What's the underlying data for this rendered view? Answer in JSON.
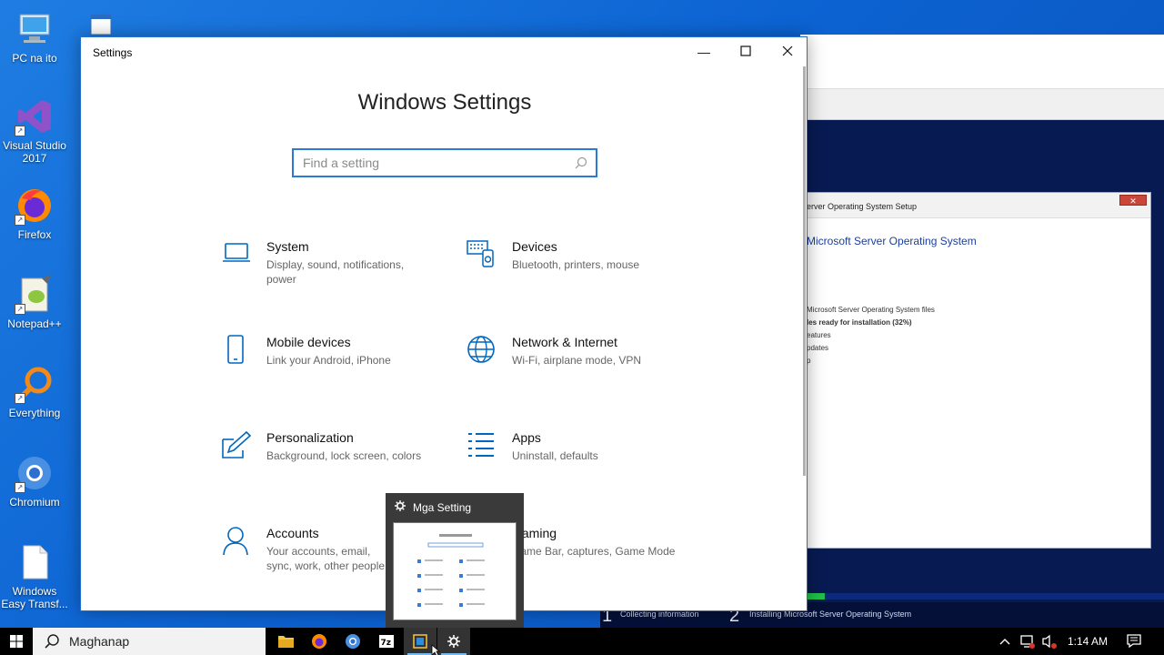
{
  "desktop": {
    "icons": [
      {
        "label": "PC na ito"
      },
      {
        "label": "Visual Studio 2017"
      },
      {
        "label": "Firefox"
      },
      {
        "label": "Notepad++"
      },
      {
        "label": "Everything"
      },
      {
        "label": "Chromium"
      },
      {
        "label": "Windows Easy Transf..."
      }
    ]
  },
  "background_window": {
    "setup_title": "erver Operating System Setup",
    "setup_heading": "Microsoft Server Operating System",
    "lines": [
      "Microsoft Server Operating System files",
      "les ready for installation (32%)",
      "eatures",
      "pdates",
      "p"
    ],
    "progress_fraction": 0.05,
    "steps": [
      {
        "num": "1",
        "label": "Collecting information"
      },
      {
        "num": "2",
        "label": "Installing Microsoft Server Operating System"
      }
    ]
  },
  "settings": {
    "window_title": "Settings",
    "heading": "Windows Settings",
    "search_placeholder": "Find a setting",
    "categories": [
      {
        "name": "System",
        "desc": "Display, sound, notifications, power",
        "icon": "laptop-icon"
      },
      {
        "name": "Devices",
        "desc": "Bluetooth, printers, mouse",
        "icon": "keyboard-icon"
      },
      {
        "name": "Mobile devices",
        "desc": "Link your Android, iPhone",
        "icon": "phone-icon"
      },
      {
        "name": "Network & Internet",
        "desc": "Wi-Fi, airplane mode, VPN",
        "icon": "globe-icon"
      },
      {
        "name": "Personalization",
        "desc": "Background, lock screen, colors",
        "icon": "paint-icon"
      },
      {
        "name": "Apps",
        "desc": "Uninstall, defaults",
        "icon": "apps-list-icon"
      },
      {
        "name": "Accounts",
        "desc": "Your accounts, email, sync, work, other people",
        "icon": "person-icon"
      },
      {
        "name": "Gaming",
        "desc": "Game Bar, captures, Game Mode",
        "icon": "xbox-icon"
      }
    ]
  },
  "thumbnail": {
    "title": "Mga Setting"
  },
  "taskbar": {
    "search_label": "Maghanap",
    "time": "1:14 AM"
  },
  "colors": {
    "accent": "#0067c0",
    "desktop_blue": "#0c63d2",
    "taskbar": "#000000"
  }
}
